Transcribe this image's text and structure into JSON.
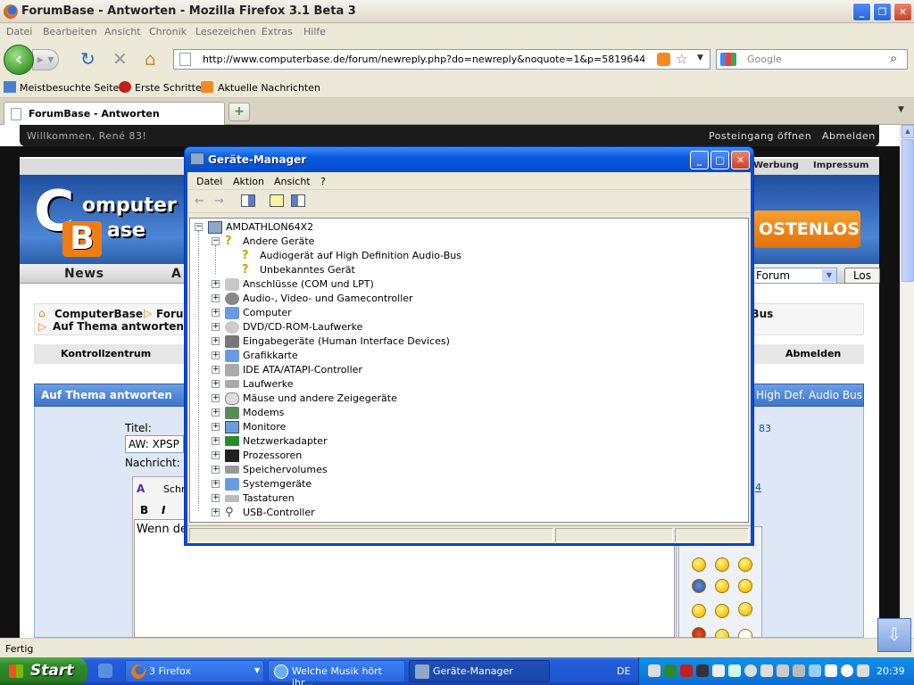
{
  "firefox": {
    "title": "ForumBase - Antworten - Mozilla Firefox 3.1 Beta 3",
    "menu": [
      "Datei",
      "Bearbeiten",
      "Ansicht",
      "Chronik",
      "Lesezeichen",
      "Extras",
      "Hilfe"
    ],
    "url": "http://www.computerbase.de/forum/newreply.php?do=newreply&noquote=1&p=5819644",
    "search_placeholder": "Google",
    "bookmarks": [
      "Meistbesuchte Seiten",
      "Erste Schritte",
      "Aktuelle Nachrichten"
    ],
    "tab_title": "ForumBase - Antworten",
    "status": "Fertig"
  },
  "site": {
    "welcome": "Willkommen, René 83!",
    "inbox": "Posteingang öffnen",
    "logout": "Abmelden",
    "toplinks": [
      "Werbung",
      "Impressum"
    ],
    "logo_c": "C",
    "logo_omputer": "omputer",
    "logo_b": "B",
    "logo_ase": "ase",
    "ad_text": "OSTENLOS",
    "nav": [
      "News",
      "A"
    ],
    "forum_select": "Forum",
    "go_button": "Los",
    "breadcrumb_home": "ComputerBase",
    "breadcrumb_forum": "Foru",
    "breadcrumb_current": "Auf Thema antworten",
    "breadcrumb_right": "o Bus",
    "control_center": "Kontrollzentrum",
    "control_logout": "Abmelden",
    "reply_header": "Auf Thema antworten",
    "reply_header_right": "High Def. Audio Bus",
    "title_label": "Titel:",
    "title_value": "AW: XPSP",
    "message_label": "Nachricht:",
    "font_label": "Schr",
    "editor_text": "Wenn de",
    "right_num1": "83",
    "right_num2": "4"
  },
  "device_manager": {
    "title": "Geräte-Manager",
    "menu": [
      "Datei",
      "Aktion",
      "Ansicht",
      "?"
    ],
    "root": "AMDATHLON64X2",
    "other_devices": "Andere Geräte",
    "other_children": [
      "Audiogerät auf High Definition Audio-Bus",
      "Unbekanntes Gerät"
    ],
    "categories": [
      {
        "label": "Anschlüsse (COM und LPT)",
        "icon": "port-icon"
      },
      {
        "label": "Audio-, Video- und Gamecontroller",
        "icon": "speaker-icon"
      },
      {
        "label": "Computer",
        "icon": "computer-icon"
      },
      {
        "label": "DVD/CD-ROM-Laufwerke",
        "icon": "cdrom-icon"
      },
      {
        "label": "Eingabegeräte (Human Interface Devices)",
        "icon": "hid-icon"
      },
      {
        "label": "Grafikkarte",
        "icon": "display-adapter-icon"
      },
      {
        "label": "IDE ATA/ATAPI-Controller",
        "icon": "ide-icon"
      },
      {
        "label": "Laufwerke",
        "icon": "disk-drive-icon"
      },
      {
        "label": "Mäuse und andere Zeigegeräte",
        "icon": "mouse-icon"
      },
      {
        "label": "Modems",
        "icon": "modem-icon"
      },
      {
        "label": "Monitore",
        "icon": "monitor-icon"
      },
      {
        "label": "Netzwerkadapter",
        "icon": "network-adapter-icon"
      },
      {
        "label": "Prozessoren",
        "icon": "processor-icon"
      },
      {
        "label": "Speichervolumes",
        "icon": "storage-volume-icon"
      },
      {
        "label": "Systemgeräte",
        "icon": "system-device-icon"
      },
      {
        "label": "Tastaturen",
        "icon": "keyboard-icon"
      },
      {
        "label": "USB-Controller",
        "icon": "usb-icon"
      }
    ]
  },
  "taskbar": {
    "start": "Start",
    "buttons": [
      "3 Firefox",
      "Welche Musik hört ihr...",
      "Geräte-Manager"
    ],
    "language": "DE",
    "clock": "20:39"
  },
  "colors": {
    "xp_blue": "#0a5ae0",
    "cb_orange": "#f07c14",
    "start_green": "#2e8a2a"
  }
}
